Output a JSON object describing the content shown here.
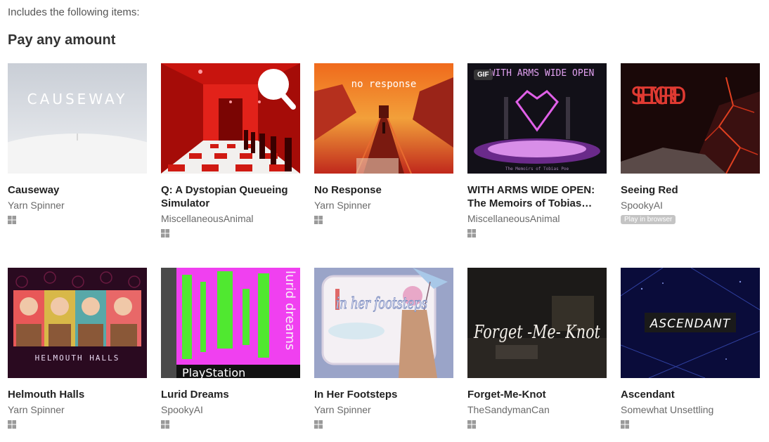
{
  "intro": "Includes the following items:",
  "section_title": "Pay any amount",
  "games": [
    {
      "title": "Causeway",
      "author": "Yarn Spinner",
      "platform": "windows-icon",
      "cover_text": "CAUSEWAY"
    },
    {
      "title": "Q: A Dystopian Queueing Simulator",
      "author": "MiscellaneousAnimal",
      "platform": "windows-icon"
    },
    {
      "title": "No Response",
      "author": "Yarn Spinner",
      "platform": "windows-icon",
      "cover_text": "no response"
    },
    {
      "title": "WITH ARMS WIDE OPEN: The Memoirs of Tobias…",
      "author": "MiscellaneousAnimal",
      "platform": "windows-icon",
      "gif_label": "GIF",
      "cover_text": "WITH ARMS WIDE OPEN",
      "cover_subtext": "The Memoirs of Tobias Poe"
    },
    {
      "title": "Seeing Red",
      "author": "SpookyAI",
      "badge": "Play in browser",
      "cover_text": "SEEING RED"
    },
    {
      "title": "Helmouth Halls",
      "author": "Yarn Spinner",
      "platform": "windows-icon",
      "cover_text": "HELMOUTH HALLS"
    },
    {
      "title": "Lurid Dreams",
      "author": "SpookyAI",
      "platform": "windows-icon",
      "cover_text": "lurid dreams",
      "cover_subtext": "PlayStation"
    },
    {
      "title": "In Her Footsteps",
      "author": "Yarn Spinner",
      "platform": "windows-icon",
      "cover_text": "in her footsteps"
    },
    {
      "title": "Forget-Me-Knot",
      "author": "TheSandymanCan",
      "platform": "windows-icon",
      "cover_text": "Forget -Me- Knot"
    },
    {
      "title": "Ascendant",
      "author": "Somewhat Unsettling",
      "platform": "windows-icon",
      "cover_text": "ASCENDANT"
    }
  ],
  "colors": {
    "title": "#222222",
    "author": "#6a6a6a",
    "badge_bg": "#c4c4c4",
    "icon": "#9a9a9a"
  }
}
